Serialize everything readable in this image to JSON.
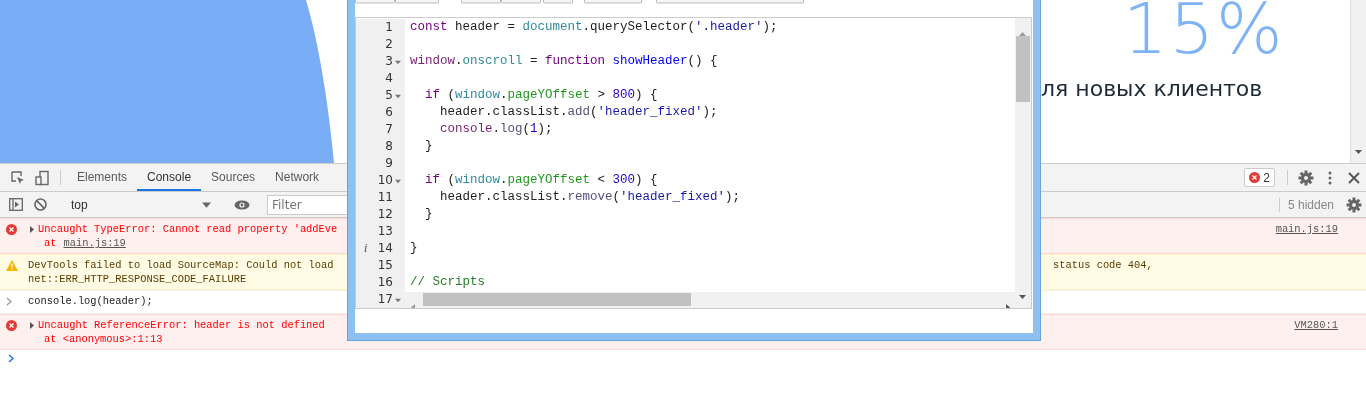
{
  "page": {
    "headline": "15%",
    "subtitle": "ля новых клиентов"
  },
  "devtools": {
    "tabs": [
      {
        "label": "Elements",
        "selected": false
      },
      {
        "label": "Console",
        "selected": true
      },
      {
        "label": "Sources",
        "selected": false
      },
      {
        "label": "Network",
        "selected": false
      }
    ],
    "error_count": "2",
    "context": "top",
    "filter": {
      "placeholder": "Filter"
    },
    "hidden": "5 hidden",
    "messages": [
      {
        "kind": "error",
        "expandable": true,
        "text": "Uncaught TypeError: Cannot read property 'addEve",
        "trace": {
          "text": "at",
          "link": "main.js:19"
        },
        "source": "main.js:19"
      },
      {
        "kind": "warning",
        "text": "DevTools failed to load SourceMap: Could not load",
        "text_right": "status code 404,",
        "second_line": "net::ERR_HTTP_RESPONSE_CODE_FAILURE"
      },
      {
        "kind": "input",
        "text": "console.log(header);"
      },
      {
        "kind": "error",
        "expandable": true,
        "text": "Uncaught ReferenceError: header is not defined",
        "trace": {
          "text": "at <anonymous>:1:13"
        },
        "source": "VM280:1"
      }
    ]
  },
  "editor": {
    "lines": [
      {
        "number": "1",
        "fold": false,
        "tokens": [
          {
            "text": "const",
            "kind": "keyword"
          },
          {
            "text": " header = ",
            "kind": "plain"
          },
          {
            "text": "document",
            "kind": "builtin"
          },
          {
            "text": ".querySelector(",
            "kind": "plain"
          },
          {
            "text": "'.header'",
            "kind": "string"
          },
          {
            "text": ");",
            "kind": "plain"
          }
        ]
      },
      {
        "number": "2",
        "fold": false
      },
      {
        "number": "3",
        "fold": true,
        "tokens": [
          {
            "text": "window",
            "kind": "global"
          },
          {
            "text": ".",
            "kind": "plain"
          },
          {
            "text": "onscroll",
            "kind": "builtin"
          },
          {
            "text": " = ",
            "kind": "plain"
          },
          {
            "text": "function",
            "kind": "keyword"
          },
          {
            "text": " showHeader",
            "kind": "def"
          },
          {
            "text": "() {",
            "kind": "plain"
          }
        ]
      },
      {
        "number": "4",
        "fold": false
      },
      {
        "number": "5",
        "fold": true,
        "tokens": [
          {
            "text": "  if",
            "kind": "keyword"
          },
          {
            "text": " (",
            "kind": "plain"
          },
          {
            "text": "window",
            "kind": "builtin"
          },
          {
            "text": ".",
            "kind": "plain"
          },
          {
            "text": "pageYOffset",
            "kind": "property"
          },
          {
            "text": " > ",
            "kind": "plain"
          },
          {
            "text": "800",
            "kind": "number"
          },
          {
            "text": ") {",
            "kind": "plain"
          }
        ]
      },
      {
        "number": "6",
        "fold": false,
        "tokens": [
          {
            "text": "    header.classList.",
            "kind": "plain"
          },
          {
            "text": "add",
            "kind": "method"
          },
          {
            "text": "(",
            "kind": "plain"
          },
          {
            "text": "'header_fixed'",
            "kind": "string"
          },
          {
            "text": ");",
            "kind": "plain"
          }
        ]
      },
      {
        "number": "7",
        "fold": false,
        "tokens": [
          {
            "text": "    console",
            "kind": "global"
          },
          {
            "text": ".",
            "kind": "plain"
          },
          {
            "text": "log",
            "kind": "method"
          },
          {
            "text": "(",
            "kind": "plain"
          },
          {
            "text": "1",
            "kind": "number"
          },
          {
            "text": ");",
            "kind": "plain"
          }
        ]
      },
      {
        "number": "8",
        "fold": false,
        "tokens": [
          {
            "text": "  }",
            "kind": "plain"
          }
        ]
      },
      {
        "number": "9",
        "fold": false
      },
      {
        "number": "10",
        "fold": true,
        "tokens": [
          {
            "text": "  if",
            "kind": "keyword"
          },
          {
            "text": " (",
            "kind": "plain"
          },
          {
            "text": "window",
            "kind": "builtin"
          },
          {
            "text": ".",
            "kind": "plain"
          },
          {
            "text": "pageYOffset",
            "kind": "property"
          },
          {
            "text": " < ",
            "kind": "plain"
          },
          {
            "text": "300",
            "kind": "number"
          },
          {
            "text": ") {",
            "kind": "plain"
          }
        ]
      },
      {
        "number": "11",
        "fold": false,
        "tokens": [
          {
            "text": "    header.classList.",
            "kind": "plain"
          },
          {
            "text": "remove",
            "kind": "method"
          },
          {
            "text": "(",
            "kind": "plain"
          },
          {
            "text": "'header_fixed'",
            "kind": "string"
          },
          {
            "text": ");",
            "kind": "plain"
          }
        ]
      },
      {
        "number": "12",
        "fold": false,
        "tokens": [
          {
            "text": "  }",
            "kind": "plain"
          }
        ]
      },
      {
        "number": "13",
        "fold": false
      },
      {
        "number": "14",
        "fold": false,
        "marker": "i",
        "tokens": [
          {
            "text": "}",
            "kind": "plain"
          }
        ]
      },
      {
        "number": "15",
        "fold": false
      },
      {
        "number": "16",
        "fold": false,
        "tokens": [
          {
            "text": "// Scripts",
            "kind": "comment"
          }
        ]
      },
      {
        "number": "17",
        "fold": true
      }
    ]
  }
}
